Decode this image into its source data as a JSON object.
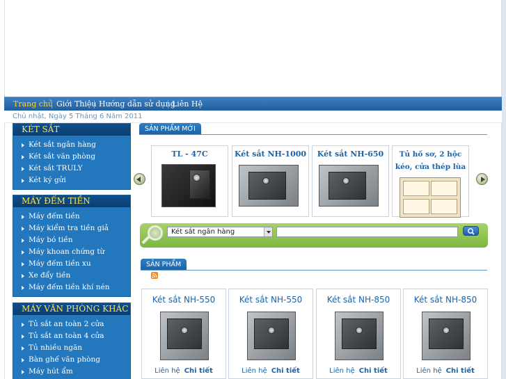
{
  "nav": {
    "items": [
      {
        "label": "Trang chủ",
        "active": true
      },
      {
        "label": "Giới Thiệu",
        "active": false
      },
      {
        "label": "Hướng dẫn sử dụng",
        "active": false
      },
      {
        "label": "Liên Hệ",
        "active": false
      }
    ]
  },
  "date_text": "Chủ nhật, Ngày 5 Tháng 6 Năm 2011",
  "sidebar": {
    "sections": [
      {
        "title": "KÉT SẮT",
        "items": [
          "Két sắt ngân hàng",
          "Két sắt văn phòng",
          "Két sắt TRULY",
          "Két ký gửi"
        ]
      },
      {
        "title": "MÁY ĐẾM TIỀN",
        "items": [
          "Máy đếm tiền",
          "Máy kiểm tra tiền giả",
          "Máy bó tiền",
          "Máy khoan chứng từ",
          "Máy đếm tiền xu",
          "Xe đẩy tiền",
          "Máy đếm tiền khí nén"
        ]
      },
      {
        "title": "MÁY VĂN PHÒNG KHÁC",
        "items": [
          "Tủ sắt an toàn 2 cửa",
          "Tủ sắt an toàn 4 cửa",
          "Tủ nhiều ngăn",
          "Bàn ghế văn phòng",
          "Máy hút ẩm"
        ]
      }
    ]
  },
  "new_products": {
    "tab_label": "SẢN PHẨM MỚI",
    "items": [
      {
        "title": "TL - 47C"
      },
      {
        "title": "Két sắt NH-1000"
      },
      {
        "title": "Két sắt NH-650"
      },
      {
        "title": "Tủ hồ sơ, 2 hộc kéo, cửa thép lùa"
      }
    ]
  },
  "search": {
    "category_value": "Két sắt ngân hàng",
    "keyword_value": ""
  },
  "products": {
    "tab_label": "SẢN PHẨM",
    "items": [
      {
        "title": "Két sắt NH-550",
        "contact": "Liên hệ",
        "detail": "Chi tiết"
      },
      {
        "title": "Két sắt NH-550",
        "contact": "Liên hệ",
        "detail": "Chi tiết"
      },
      {
        "title": "Két sắt NH-850",
        "contact": "Liên hệ",
        "detail": "Chi tiết"
      },
      {
        "title": "Két sắt NH-850",
        "contact": "Liên hệ",
        "detail": "Chi tiết"
      }
    ]
  },
  "colors": {
    "nav_active": "#ffd23a",
    "sidebar_heading": "#ffe34a",
    "link_blue": "#1d63a6",
    "search_green": "#8cc04f"
  }
}
